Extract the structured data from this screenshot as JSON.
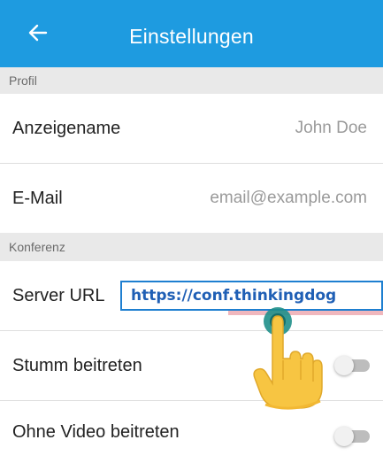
{
  "header": {
    "back_icon": "arrow-left-icon",
    "title": "Einstellungen"
  },
  "sections": {
    "profile": "Profil",
    "conference": "Konferenz"
  },
  "profile": {
    "display_name_label": "Anzeigename",
    "display_name_value": "John Doe",
    "email_label": "E-Mail",
    "email_placeholder": "email@example.com"
  },
  "conference": {
    "server_url_label": "Server URL",
    "server_url_value": "https://conf.thinkingdog",
    "start_muted_label": "Stumm beitreten",
    "start_muted_on": false,
    "no_video_label": "Ohne Video beitreten",
    "no_video_on": false
  },
  "colors": {
    "accent": "#1e9be0",
    "field_border": "#1e7fd0",
    "url_text": "#1f5fb5"
  },
  "overlay": {
    "icon": "tap-hand-icon"
  }
}
